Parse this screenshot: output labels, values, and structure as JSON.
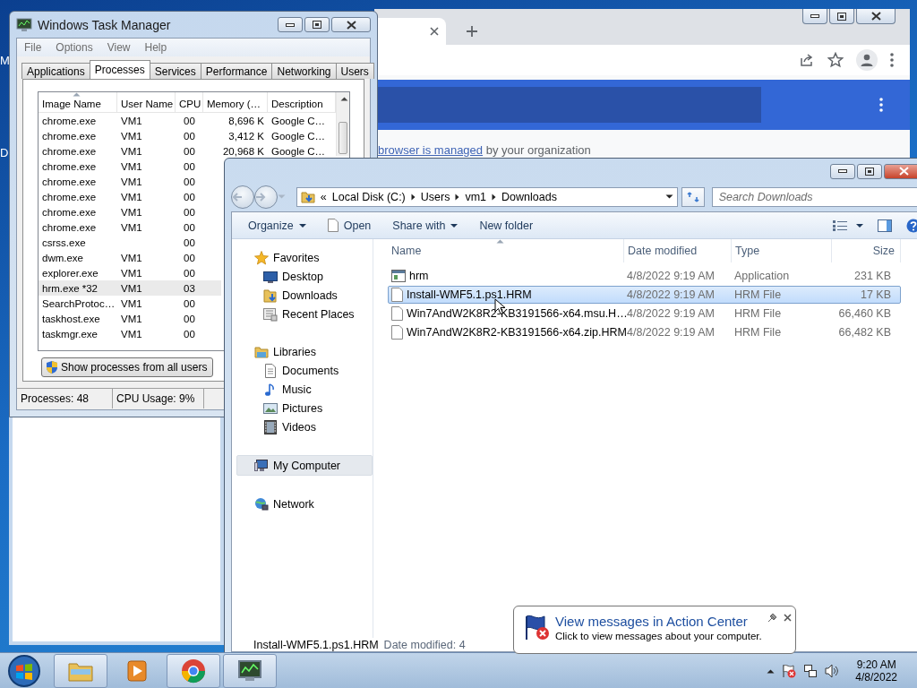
{
  "desktop": {
    "edge_labels": [
      "M",
      "D"
    ]
  },
  "browser": {
    "managed_note": {
      "link": "browser is managed",
      "text": "by your organization"
    }
  },
  "task_manager": {
    "title": "Windows Task Manager",
    "menu": [
      "File",
      "Options",
      "View",
      "Help"
    ],
    "tabs": [
      {
        "label": "Applications",
        "selected": false
      },
      {
        "label": "Processes",
        "selected": true
      },
      {
        "label": "Services",
        "selected": false
      },
      {
        "label": "Performance",
        "selected": false
      },
      {
        "label": "Networking",
        "selected": false
      },
      {
        "label": "Users",
        "selected": false
      }
    ],
    "columns": [
      "Image Name",
      "User Name",
      "CPU",
      "Memory (…",
      "Description"
    ],
    "rows": [
      {
        "cells": [
          "chrome.exe",
          "VM1",
          "00",
          "8,696 K",
          "Google C…"
        ],
        "selected": false
      },
      {
        "cells": [
          "chrome.exe",
          "VM1",
          "00",
          "3,412 K",
          "Google C…"
        ],
        "selected": false
      },
      {
        "cells": [
          "chrome.exe",
          "VM1",
          "00",
          "20,968 K",
          "Google C…"
        ],
        "selected": false
      },
      {
        "cells": [
          "chrome.exe",
          "VM1",
          "00"
        ],
        "selected": false
      },
      {
        "cells": [
          "chrome.exe",
          "VM1",
          "00"
        ],
        "selected": false
      },
      {
        "cells": [
          "chrome.exe",
          "VM1",
          "00"
        ],
        "selected": false
      },
      {
        "cells": [
          "chrome.exe",
          "VM1",
          "00"
        ],
        "selected": false
      },
      {
        "cells": [
          "chrome.exe",
          "VM1",
          "00"
        ],
        "selected": false
      },
      {
        "cells": [
          "csrss.exe",
          "",
          "00"
        ],
        "selected": false
      },
      {
        "cells": [
          "dwm.exe",
          "VM1",
          "00"
        ],
        "selected": false
      },
      {
        "cells": [
          "explorer.exe",
          "VM1",
          "00"
        ],
        "selected": false
      },
      {
        "cells": [
          "hrm.exe *32",
          "VM1",
          "03"
        ],
        "selected": true
      },
      {
        "cells": [
          "SearchProtoc…",
          "VM1",
          "00"
        ],
        "selected": false
      },
      {
        "cells": [
          "taskhost.exe",
          "VM1",
          "00"
        ],
        "selected": false
      },
      {
        "cells": [
          "taskmgr.exe",
          "VM1",
          "00"
        ],
        "selected": false
      }
    ],
    "button": "Show processes from all users",
    "status": [
      "Processes: 48",
      "CPU Usage: 9%"
    ]
  },
  "explorer": {
    "overflow_mark": "«",
    "breadcrumb": [
      "Local Disk (C:)",
      "Users",
      "vm1",
      "Downloads"
    ],
    "search": {
      "placeholder": "Search Downloads"
    },
    "toolbar": [
      {
        "label": "Organize",
        "kind": "menu"
      },
      {
        "label": "Open",
        "kind": "open"
      },
      {
        "label": "Share with",
        "kind": "menu"
      },
      {
        "label": "New folder",
        "kind": "plain"
      }
    ],
    "nav": [
      {
        "label": "Favorites",
        "kind": "star",
        "selected": false,
        "children": [
          {
            "label": "Desktop",
            "kind": "desktop",
            "selected": false
          },
          {
            "label": "Downloads",
            "kind": "downloads",
            "selected": false
          },
          {
            "label": "Recent Places",
            "kind": "recent",
            "selected": false
          }
        ]
      },
      {
        "label": "Libraries",
        "kind": "libraries",
        "selected": false,
        "children": [
          {
            "label": "Documents",
            "kind": "documents",
            "selected": false
          },
          {
            "label": "Music",
            "kind": "music",
            "selected": false
          },
          {
            "label": "Pictures",
            "kind": "pictures",
            "selected": false
          },
          {
            "label": "Videos",
            "kind": "videos",
            "selected": false
          }
        ]
      },
      {
        "label": "My Computer",
        "kind": "computer",
        "selected": true
      },
      {
        "label": "Network",
        "kind": "network",
        "selected": false
      }
    ],
    "columns": [
      "Name",
      "Date modified",
      "Type",
      "Size"
    ],
    "files": [
      {
        "name": "hrm",
        "kind": "app",
        "modified": "4/8/2022 9:19 AM",
        "type": "Application",
        "size": "231 KB",
        "selected": false
      },
      {
        "name": "Install-WMF5.1.ps1.HRM",
        "kind": "file",
        "modified": "4/8/2022 9:19 AM",
        "type": "HRM File",
        "size": "17 KB",
        "selected": true
      },
      {
        "name": "Win7AndW2K8R2-KB3191566-x64.msu.H…",
        "kind": "file",
        "modified": "4/8/2022 9:19 AM",
        "type": "HRM File",
        "size": "66,460 KB",
        "selected": false
      },
      {
        "name": "Win7AndW2K8R2-KB3191566-x64.zip.HRM",
        "kind": "file",
        "modified": "4/8/2022 9:19 AM",
        "type": "HRM File",
        "size": "66,482 KB",
        "selected": false
      }
    ],
    "details": {
      "name": "Install-WMF5.1.ps1.HRM",
      "text": "Date modified: 4"
    }
  },
  "notification": {
    "title": "View messages in Action Center",
    "text": "Click to view messages about your computer."
  },
  "taskbar": {
    "apps": [
      {
        "kind": "folder",
        "active": true
      },
      {
        "kind": "media",
        "active": false
      },
      {
        "kind": "browser",
        "active": true
      },
      {
        "kind": "monitor",
        "active": true
      }
    ],
    "clock": {
      "time": "9:20 AM",
      "date": "4/8/2022"
    }
  }
}
